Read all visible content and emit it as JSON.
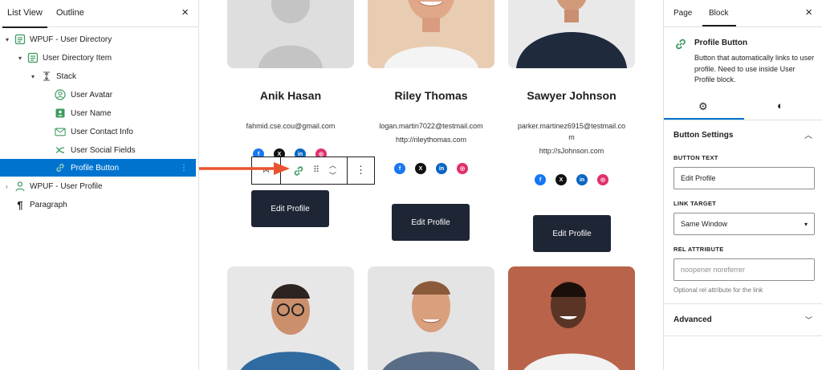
{
  "left_panel": {
    "tabs": [
      "List View",
      "Outline"
    ],
    "close": "×",
    "tree": [
      {
        "label": "WPUF - User Directory"
      },
      {
        "label": "User Directory Item"
      },
      {
        "label": "Stack"
      },
      {
        "label": "User Avatar"
      },
      {
        "label": "User Name"
      },
      {
        "label": "User Contact Info"
      },
      {
        "label": "User Social Fields"
      },
      {
        "label": "Profile Button"
      },
      {
        "label": "WPUF - User Profile"
      },
      {
        "label": "Paragraph"
      }
    ]
  },
  "canvas": {
    "users": [
      {
        "name": "Anik Hasan",
        "email": "fahmid.cse.cou@gmail.com",
        "url": "",
        "button": "Edit Profile"
      },
      {
        "name": "Riley Thomas",
        "email": "logan.martin7022@testmail.com",
        "url": "http://rileythomas.com",
        "button": "Edit Profile"
      },
      {
        "name": "Sawyer Johnson",
        "email": "parker.martinez6915@testmail.co",
        "email2": "m",
        "url": "http://sJohnson.com",
        "button": "Edit Profile"
      }
    ],
    "social": [
      "f",
      "X",
      "in",
      "◎"
    ],
    "colors": {
      "facebook": "#1877f2",
      "x": "#111111",
      "linkedin": "#0a66c2",
      "instagram": "#e1306c",
      "button": "#1e2636",
      "arrow": "#e8542f"
    }
  },
  "right_panel": {
    "tabs": [
      "Page",
      "Block"
    ],
    "close": "×",
    "block_title": "Profile Button",
    "block_desc": "Button that automatically links to user profile. Need to use inside User Profile block.",
    "section_title": "Button Settings",
    "button_text_label": "BUTTON TEXT",
    "button_text_value": "Edit Profile",
    "link_target_label": "LINK TARGET",
    "link_target_value": "Same Window",
    "rel_label": "REL ATTRIBUTE",
    "rel_placeholder": "noopener noreferrer",
    "rel_help": "Optional rel attribute for the link",
    "advanced": "Advanced"
  }
}
